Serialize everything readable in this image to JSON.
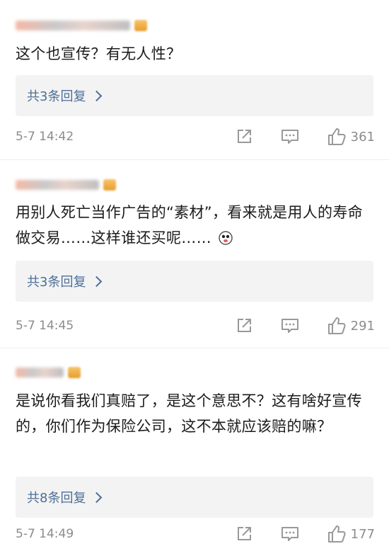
{
  "comments": [
    {
      "text": "这个也宣传？有无人性？",
      "reply_label": "共3条回复",
      "time": "5-7 14:42",
      "likes": "361"
    },
    {
      "text": "用别人死亡当作广告的“素材”，看来就是用人的寿命做交易……这样谁还买呢……",
      "reply_label": "共3条回复",
      "time": "5-7 14:45",
      "likes": "291"
    },
    {
      "text": "是说你看我们真赔了，是这个意思不？这有啥好宣传的，你们作为保险公司，这不本就应该赔的嘛？",
      "reply_label": "共8条回复",
      "time": "5-7 14:49",
      "likes": "177"
    }
  ],
  "icons": {
    "share": "share-icon",
    "comment": "comment-icon",
    "like": "thumbs-up-icon",
    "emoji": "emoji-icon"
  },
  "colors": {
    "link": "#4c6f98",
    "meta": "#8c8c8c",
    "reply_bg": "#f3f3f3"
  }
}
